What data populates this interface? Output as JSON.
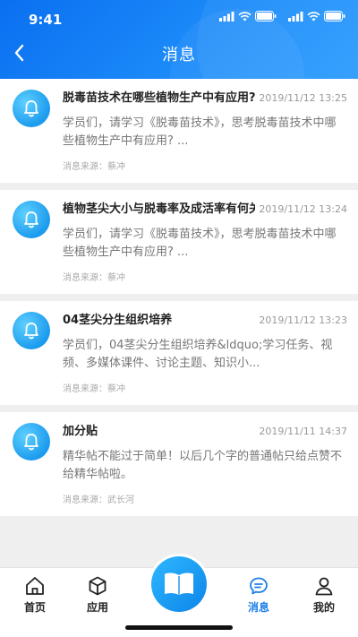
{
  "status_bar": {
    "time": "9:41"
  },
  "header": {
    "title": "消息"
  },
  "messages": [
    {
      "title": "脱毒苗技术在哪些植物生产中有应用?",
      "time": "2019/11/12 13:25",
      "body": "学员们，请学习《脱毒苗技术》，思考脱毒苗技术中哪些植物生产中有应用? ...",
      "source": "消息来源：蔡冲"
    },
    {
      "title": "植物茎尖大小与脱毒率及成活率有何关系?",
      "time": "2019/11/12 13:24",
      "body": "学员们，请学习《脱毒苗技术》，思考脱毒苗技术中哪些植物生产中有应用? ...",
      "source": "消息来源：蔡冲"
    },
    {
      "title": "04茎尖分生组织培养",
      "time": "2019/11/12 13:23",
      "body": "学员们，04茎尖分生组织培养&ldquo;学习任务、视频、多媒体课件、讨论主题、知识小...",
      "source": "消息来源：蔡冲"
    },
    {
      "title": "加分贴",
      "time": "2019/11/11 14:37",
      "body": "精华帖不能过于简单！以后几个字的普通帖只给点赞不给精华帖啦。",
      "source": "消息来源：武长河"
    }
  ],
  "tabbar": {
    "home": "首页",
    "app": "应用",
    "messages": "消息",
    "me": "我的",
    "active_color": "#1c7fe8"
  },
  "colors": {
    "header_start": "#0a6ff0",
    "header_end": "#2b9bff",
    "accent": "#1c9bee"
  }
}
